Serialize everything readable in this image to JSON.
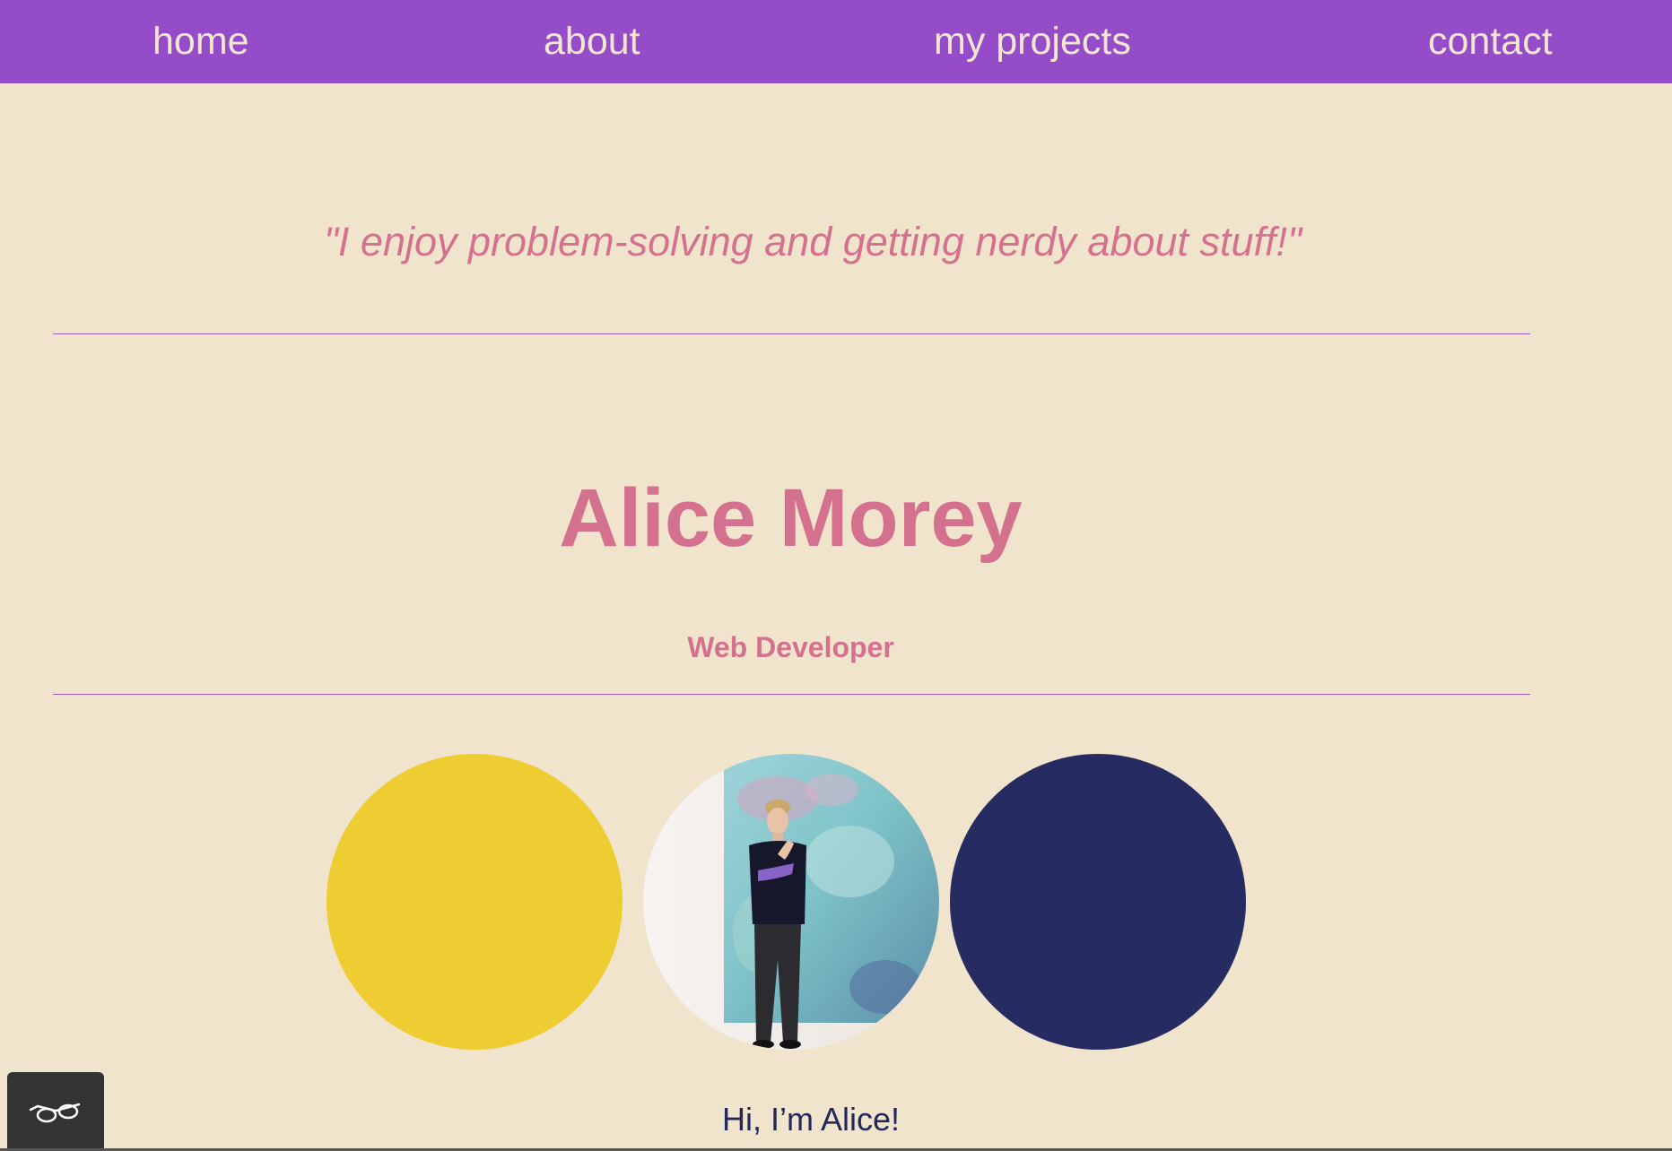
{
  "nav": {
    "items": [
      {
        "label": "home"
      },
      {
        "label": "about"
      },
      {
        "label": "my projects"
      },
      {
        "label": "contact"
      }
    ]
  },
  "hero": {
    "quote": "\"I enjoy problem-solving and getting nerdy about stuff!\"",
    "name": "Alice Morey",
    "role": "Web Developer"
  },
  "circles": {
    "left_color": "#eecd33",
    "right_color": "#262b62",
    "middle": "portrait photo"
  },
  "intro": {
    "greeting": "Hi, I’m Alice!"
  },
  "widgets": {
    "reader_icon": "eyeglasses-icon"
  },
  "colors": {
    "nav_background": "#944cc8",
    "page_background": "#f1e4cd",
    "accent_pink": "#d4718f",
    "divider": "#9a55c6"
  }
}
